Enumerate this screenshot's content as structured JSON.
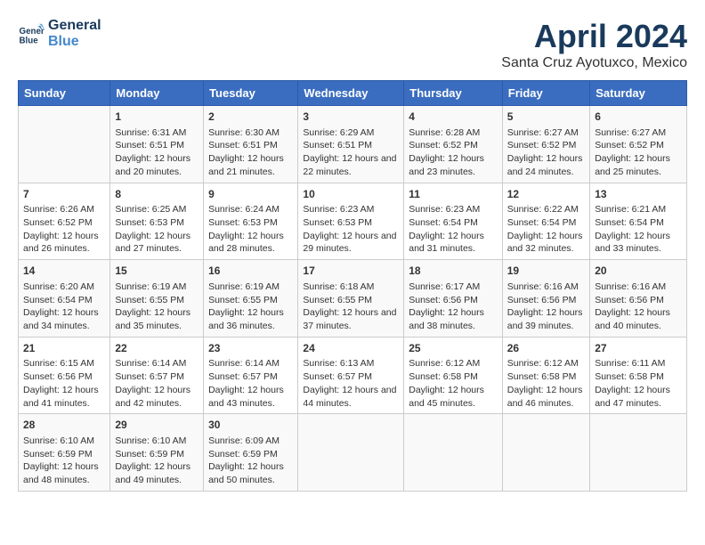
{
  "logo": {
    "line1": "General",
    "line2": "Blue"
  },
  "title": "April 2024",
  "location": "Santa Cruz Ayotuxco, Mexico",
  "days_of_week": [
    "Sunday",
    "Monday",
    "Tuesday",
    "Wednesday",
    "Thursday",
    "Friday",
    "Saturday"
  ],
  "weeks": [
    [
      {
        "day": "",
        "sunrise": "",
        "sunset": "",
        "daylight": ""
      },
      {
        "day": "1",
        "sunrise": "Sunrise: 6:31 AM",
        "sunset": "Sunset: 6:51 PM",
        "daylight": "Daylight: 12 hours and 20 minutes."
      },
      {
        "day": "2",
        "sunrise": "Sunrise: 6:30 AM",
        "sunset": "Sunset: 6:51 PM",
        "daylight": "Daylight: 12 hours and 21 minutes."
      },
      {
        "day": "3",
        "sunrise": "Sunrise: 6:29 AM",
        "sunset": "Sunset: 6:51 PM",
        "daylight": "Daylight: 12 hours and 22 minutes."
      },
      {
        "day": "4",
        "sunrise": "Sunrise: 6:28 AM",
        "sunset": "Sunset: 6:52 PM",
        "daylight": "Daylight: 12 hours and 23 minutes."
      },
      {
        "day": "5",
        "sunrise": "Sunrise: 6:27 AM",
        "sunset": "Sunset: 6:52 PM",
        "daylight": "Daylight: 12 hours and 24 minutes."
      },
      {
        "day": "6",
        "sunrise": "Sunrise: 6:27 AM",
        "sunset": "Sunset: 6:52 PM",
        "daylight": "Daylight: 12 hours and 25 minutes."
      }
    ],
    [
      {
        "day": "7",
        "sunrise": "Sunrise: 6:26 AM",
        "sunset": "Sunset: 6:52 PM",
        "daylight": "Daylight: 12 hours and 26 minutes."
      },
      {
        "day": "8",
        "sunrise": "Sunrise: 6:25 AM",
        "sunset": "Sunset: 6:53 PM",
        "daylight": "Daylight: 12 hours and 27 minutes."
      },
      {
        "day": "9",
        "sunrise": "Sunrise: 6:24 AM",
        "sunset": "Sunset: 6:53 PM",
        "daylight": "Daylight: 12 hours and 28 minutes."
      },
      {
        "day": "10",
        "sunrise": "Sunrise: 6:23 AM",
        "sunset": "Sunset: 6:53 PM",
        "daylight": "Daylight: 12 hours and 29 minutes."
      },
      {
        "day": "11",
        "sunrise": "Sunrise: 6:23 AM",
        "sunset": "Sunset: 6:54 PM",
        "daylight": "Daylight: 12 hours and 31 minutes."
      },
      {
        "day": "12",
        "sunrise": "Sunrise: 6:22 AM",
        "sunset": "Sunset: 6:54 PM",
        "daylight": "Daylight: 12 hours and 32 minutes."
      },
      {
        "day": "13",
        "sunrise": "Sunrise: 6:21 AM",
        "sunset": "Sunset: 6:54 PM",
        "daylight": "Daylight: 12 hours and 33 minutes."
      }
    ],
    [
      {
        "day": "14",
        "sunrise": "Sunrise: 6:20 AM",
        "sunset": "Sunset: 6:54 PM",
        "daylight": "Daylight: 12 hours and 34 minutes."
      },
      {
        "day": "15",
        "sunrise": "Sunrise: 6:19 AM",
        "sunset": "Sunset: 6:55 PM",
        "daylight": "Daylight: 12 hours and 35 minutes."
      },
      {
        "day": "16",
        "sunrise": "Sunrise: 6:19 AM",
        "sunset": "Sunset: 6:55 PM",
        "daylight": "Daylight: 12 hours and 36 minutes."
      },
      {
        "day": "17",
        "sunrise": "Sunrise: 6:18 AM",
        "sunset": "Sunset: 6:55 PM",
        "daylight": "Daylight: 12 hours and 37 minutes."
      },
      {
        "day": "18",
        "sunrise": "Sunrise: 6:17 AM",
        "sunset": "Sunset: 6:56 PM",
        "daylight": "Daylight: 12 hours and 38 minutes."
      },
      {
        "day": "19",
        "sunrise": "Sunrise: 6:16 AM",
        "sunset": "Sunset: 6:56 PM",
        "daylight": "Daylight: 12 hours and 39 minutes."
      },
      {
        "day": "20",
        "sunrise": "Sunrise: 6:16 AM",
        "sunset": "Sunset: 6:56 PM",
        "daylight": "Daylight: 12 hours and 40 minutes."
      }
    ],
    [
      {
        "day": "21",
        "sunrise": "Sunrise: 6:15 AM",
        "sunset": "Sunset: 6:56 PM",
        "daylight": "Daylight: 12 hours and 41 minutes."
      },
      {
        "day": "22",
        "sunrise": "Sunrise: 6:14 AM",
        "sunset": "Sunset: 6:57 PM",
        "daylight": "Daylight: 12 hours and 42 minutes."
      },
      {
        "day": "23",
        "sunrise": "Sunrise: 6:14 AM",
        "sunset": "Sunset: 6:57 PM",
        "daylight": "Daylight: 12 hours and 43 minutes."
      },
      {
        "day": "24",
        "sunrise": "Sunrise: 6:13 AM",
        "sunset": "Sunset: 6:57 PM",
        "daylight": "Daylight: 12 hours and 44 minutes."
      },
      {
        "day": "25",
        "sunrise": "Sunrise: 6:12 AM",
        "sunset": "Sunset: 6:58 PM",
        "daylight": "Daylight: 12 hours and 45 minutes."
      },
      {
        "day": "26",
        "sunrise": "Sunrise: 6:12 AM",
        "sunset": "Sunset: 6:58 PM",
        "daylight": "Daylight: 12 hours and 46 minutes."
      },
      {
        "day": "27",
        "sunrise": "Sunrise: 6:11 AM",
        "sunset": "Sunset: 6:58 PM",
        "daylight": "Daylight: 12 hours and 47 minutes."
      }
    ],
    [
      {
        "day": "28",
        "sunrise": "Sunrise: 6:10 AM",
        "sunset": "Sunset: 6:59 PM",
        "daylight": "Daylight: 12 hours and 48 minutes."
      },
      {
        "day": "29",
        "sunrise": "Sunrise: 6:10 AM",
        "sunset": "Sunset: 6:59 PM",
        "daylight": "Daylight: 12 hours and 49 minutes."
      },
      {
        "day": "30",
        "sunrise": "Sunrise: 6:09 AM",
        "sunset": "Sunset: 6:59 PM",
        "daylight": "Daylight: 12 hours and 50 minutes."
      },
      {
        "day": "",
        "sunrise": "",
        "sunset": "",
        "daylight": ""
      },
      {
        "day": "",
        "sunrise": "",
        "sunset": "",
        "daylight": ""
      },
      {
        "day": "",
        "sunrise": "",
        "sunset": "",
        "daylight": ""
      },
      {
        "day": "",
        "sunrise": "",
        "sunset": "",
        "daylight": ""
      }
    ]
  ]
}
